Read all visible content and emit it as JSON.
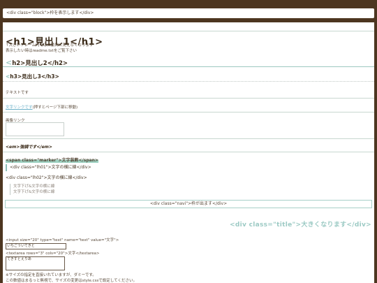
{
  "block_text": "<div class=\"block\">枠を表示します</div>",
  "h1": "<h1>見出し1</h1>",
  "h1_note_1": "↑大きいフレーム内では自動的に見えなくなります",
  "h1_note_2": "表示したい時はreadme.txtをご覧下さい",
  "h2_bracket": "<",
  "h2": "h2>見出し2</h2>",
  "h3_bracket": "<",
  "h3": "h3>見出し3</h3>",
  "text": "テキストです",
  "link_text": "文字リンクです",
  "link_note": "(押すとページ下部に移動)",
  "image_link_label": "画像リンク",
  "em": "<em>強調です</em>",
  "marker": "<span class=\"marker\">文字装飾</span>",
  "lh01": "<div class=\"lh01\">文字の横に線</div>",
  "lh02": "<div class=\"lh02\">文字の横に線</div>",
  "indent_1": "文字下げ&文字の横に線",
  "indent_2": "文字下げ&文字の横に線",
  "navi": "<div class=\"navi\">枠が出ます</div>",
  "title": "<div class=\"title\">大きくなります</div>",
  "input_code": "<input size=\"20\" type=\"text\" name=\"text\" value=\"文字\">",
  "input_value": "いちごういてきと",
  "textarea_code": "<textarea rows=\"3\" cols=\"20\">文字</textarea>",
  "textarea_value": "てきすとえりあ",
  "note_1": "※サイズの指定を直接いれていますが、ダミーです。",
  "note_2": "この数値はまるっと無視で、サイズの変更はstyle.cssで設定してください。"
}
